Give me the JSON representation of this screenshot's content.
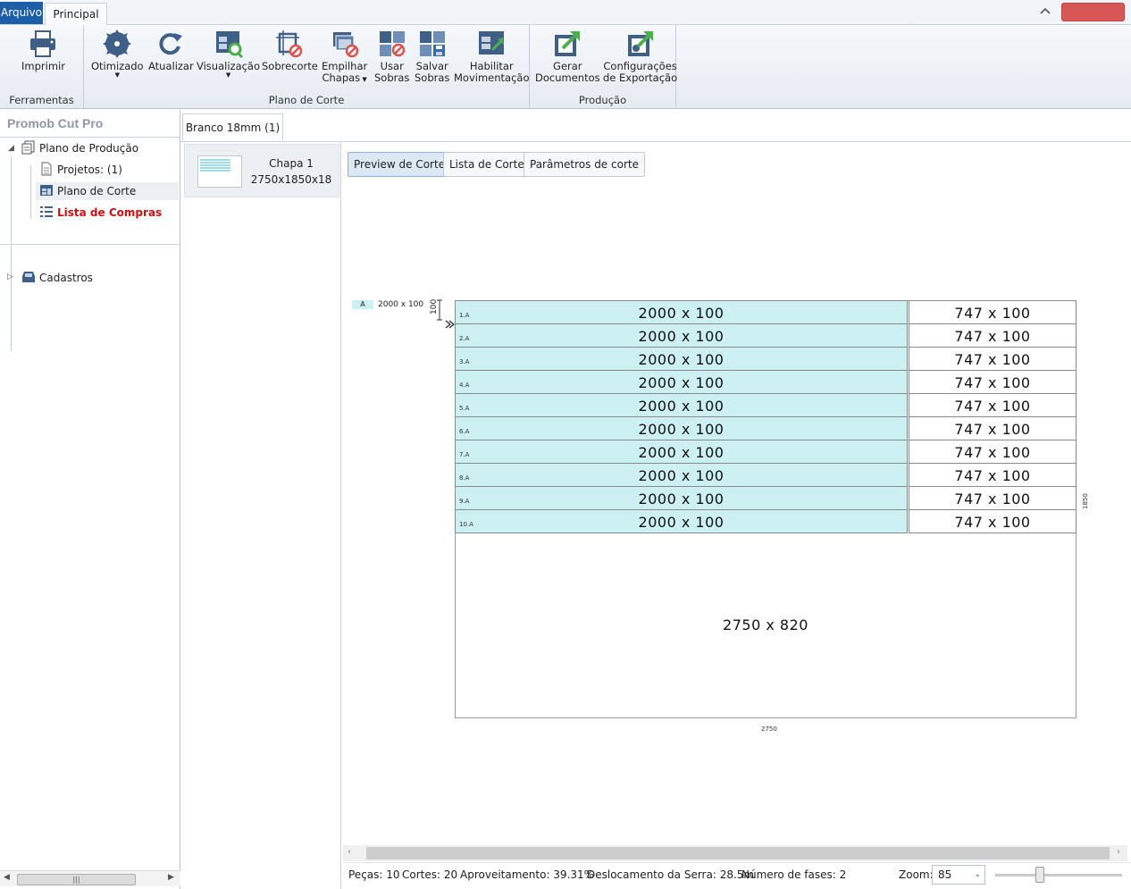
{
  "tabs": {
    "arquivo": "Arquivo",
    "principal": "Principal"
  },
  "ribbon": {
    "groups": [
      {
        "label": "Ferramentas"
      },
      {
        "label": "Plano de Corte"
      },
      {
        "label": "Produção"
      }
    ],
    "buttons": {
      "imprimir": "Imprimir",
      "otimizado": "Otimizado",
      "atualizar": "Atualizar",
      "visualizacao": "Visualização",
      "sobrecorte": "Sobrecorte",
      "empilhar_1": "Empilhar",
      "empilhar_2": "Chapas",
      "usar_1": "Usar",
      "usar_2": "Sobras",
      "salvar_1": "Salvar",
      "salvar_2": "Sobras",
      "habilitar_1": "Habilitar",
      "habilitar_2": "Movimentação",
      "gerar_1": "Gerar",
      "gerar_2": "Documentos",
      "config_1": "Configurações",
      "config_2": "de Exportação"
    },
    "icon_color": "#3f5f86",
    "accent_green": "#4cae4c",
    "accent_red": "#d9534f"
  },
  "left_panel": {
    "title": "Promob Cut Pro",
    "tree": [
      {
        "label": "Plano de Produção",
        "icon": "production-plan-icon"
      },
      {
        "label": "Projetos: (1)",
        "icon": "document-icon"
      },
      {
        "label": "Plano de Corte",
        "icon": "cut-plan-icon"
      },
      {
        "label": "Lista de Compras",
        "icon": "list-icon",
        "color": "#d01010"
      },
      {
        "label": "Cadastros",
        "icon": "inbox-icon"
      }
    ]
  },
  "document_tab": "Branco 18mm (1)",
  "sheet": {
    "name": "Chapa 1",
    "dims": "2750x1850x18"
  },
  "view_buttons": [
    "Preview de Corte",
    "Lista de Corte",
    "Parâmetros de corte"
  ],
  "preview": {
    "legend_tag": "A",
    "legend_text": "2000 x 100",
    "side_dim": "100",
    "pieces": [
      {
        "num": "1.A",
        "label": "2000 x 100",
        "remnant": "747 x 100"
      },
      {
        "num": "2.A",
        "label": "2000 x 100",
        "remnant": "747 x 100"
      },
      {
        "num": "3.A",
        "label": "2000 x 100",
        "remnant": "747 x 100"
      },
      {
        "num": "4.A",
        "label": "2000 x 100",
        "remnant": "747 x 100"
      },
      {
        "num": "5.A",
        "label": "2000 x 100",
        "remnant": "747 x 100"
      },
      {
        "num": "6.A",
        "label": "2000 x 100",
        "remnant": "747 x 100"
      },
      {
        "num": "7.A",
        "label": "2000 x 100",
        "remnant": "747 x 100"
      },
      {
        "num": "8.A",
        "label": "2000 x 100",
        "remnant": "747 x 100"
      },
      {
        "num": "9.A",
        "label": "2000 x 100",
        "remnant": "747 x 100"
      },
      {
        "num": "10.A",
        "label": "2000 x 100",
        "remnant": "747 x 100"
      }
    ],
    "waste_label": "2750 x 820",
    "width_label": "2750",
    "height_label": "1850",
    "piece_color": "#cdf0f3"
  },
  "status": {
    "pecas": "Peças: 10",
    "cortes": "Cortes: 20",
    "aproveitamento": "Aproveitamento: 39.31%",
    "deslocamento": "Deslocamento da Serra: 28.5m",
    "fases": "Número de fases: 2",
    "zoom_label": "Zoom:",
    "zoom_value": "85"
  }
}
